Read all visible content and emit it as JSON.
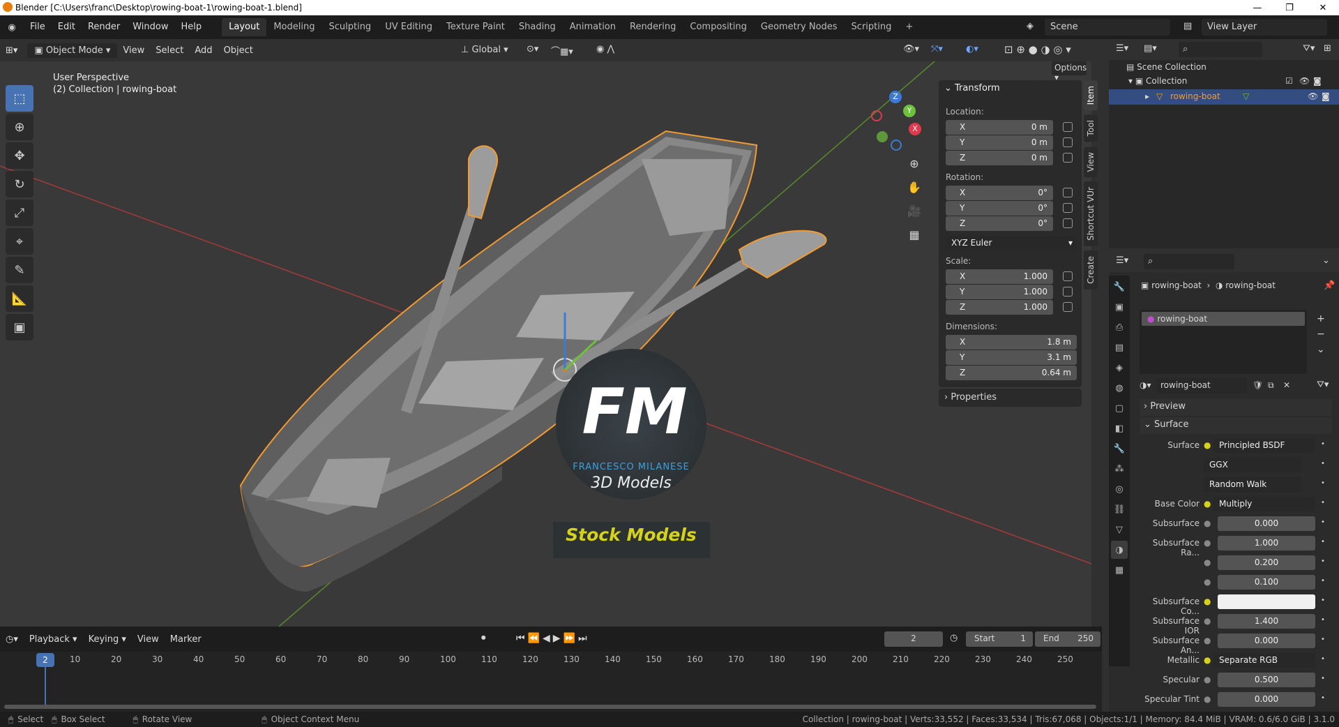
{
  "window": {
    "title": "Blender [C:\\Users\\franc\\Desktop\\rowing-boat-1\\rowing-boat-1.blend]"
  },
  "menu": [
    "File",
    "Edit",
    "Render",
    "Window",
    "Help"
  ],
  "workspaces": [
    "Layout",
    "Modeling",
    "Sculpting",
    "UV Editing",
    "Texture Paint",
    "Shading",
    "Animation",
    "Rendering",
    "Compositing",
    "Geometry Nodes",
    "Scripting"
  ],
  "scene": {
    "label": "Scene",
    "view_layer": "View Layer"
  },
  "viewport_header": {
    "mode": "Object Mode",
    "menus": [
      "View",
      "Select",
      "Add",
      "Object"
    ],
    "orientation": "Global",
    "options": "Options"
  },
  "viewport": {
    "perspective": "User Perspective",
    "collection_info": "(2) Collection | rowing-boat"
  },
  "gizmo": {
    "x": "X",
    "y": "Y",
    "z": "Z"
  },
  "watermark": {
    "letters": "FM",
    "name": "FRANCESCO MILANESE",
    "sub": "3D Models",
    "banner": "Stock Models"
  },
  "transform": {
    "title": "Transform",
    "location_label": "Location:",
    "location": [
      {
        "axis": "X",
        "value": "0 m"
      },
      {
        "axis": "Y",
        "value": "0 m"
      },
      {
        "axis": "Z",
        "value": "0 m"
      }
    ],
    "rotation_label": "Rotation:",
    "rotation": [
      {
        "axis": "X",
        "value": "0°"
      },
      {
        "axis": "Y",
        "value": "0°"
      },
      {
        "axis": "Z",
        "value": "0°"
      }
    ],
    "rotation_mode": "XYZ Euler",
    "scale_label": "Scale:",
    "scale": [
      {
        "axis": "X",
        "value": "1.000"
      },
      {
        "axis": "Y",
        "value": "1.000"
      },
      {
        "axis": "Z",
        "value": "1.000"
      }
    ],
    "dimensions_label": "Dimensions:",
    "dimensions": [
      {
        "axis": "X",
        "value": "1.8 m"
      },
      {
        "axis": "Y",
        "value": "3.1 m"
      },
      {
        "axis": "Z",
        "value": "0.64 m"
      }
    ],
    "properties": "Properties"
  },
  "side_tabs": [
    "Item",
    "Tool",
    "View",
    "Shortcut VUr",
    "Create"
  ],
  "outliner": {
    "scene_collection": "Scene Collection",
    "collection": "Collection",
    "object": "rowing-boat"
  },
  "properties": {
    "breadcrumb_object": "rowing-boat",
    "breadcrumb_material": "rowing-boat",
    "slot": "rowing-boat",
    "material_name": "rowing-boat",
    "preview": "Preview",
    "surface_section": "Surface",
    "rows": [
      {
        "label": "Surface",
        "value": "Principled BSDF",
        "kind": "drop"
      },
      {
        "label": "",
        "value": "GGX",
        "kind": "select"
      },
      {
        "label": "",
        "value": "Random Walk",
        "kind": "select"
      },
      {
        "label": "Base Color",
        "value": "Multiply",
        "kind": "drop"
      },
      {
        "label": "Subsurface",
        "value": "0.000",
        "kind": "num"
      },
      {
        "label": "Subsurface Ra...",
        "value": "1.000",
        "kind": "num"
      },
      {
        "label": "",
        "value": "0.200",
        "kind": "num"
      },
      {
        "label": "",
        "value": "0.100",
        "kind": "num"
      },
      {
        "label": "Subsurface Co...",
        "value": "",
        "kind": "color"
      },
      {
        "label": "Subsurface IOR",
        "value": "1.400",
        "kind": "num"
      },
      {
        "label": "Subsurface An...",
        "value": "0.000",
        "kind": "num"
      },
      {
        "label": "Metallic",
        "value": "Separate RGB",
        "kind": "drop"
      },
      {
        "label": "Specular",
        "value": "0.500",
        "kind": "num"
      },
      {
        "label": "Specular Tint",
        "value": "0.000",
        "kind": "num"
      }
    ]
  },
  "timeline": {
    "menus": [
      "Playback",
      "Keying",
      "View",
      "Marker"
    ],
    "current_frame": "2",
    "start_label": "Start",
    "start": "1",
    "end_label": "End",
    "end": "250",
    "ticks": [
      "10",
      "20",
      "30",
      "40",
      "50",
      "60",
      "70",
      "80",
      "90",
      "100",
      "110",
      "120",
      "130",
      "140",
      "150",
      "160",
      "170",
      "180",
      "190",
      "200",
      "210",
      "220",
      "230",
      "240",
      "250"
    ]
  },
  "status": {
    "select": "Select",
    "box_select": "Box Select",
    "rotate": "Rotate View",
    "context_menu": "Object Context Menu",
    "stats": "Collection | rowing-boat | Verts:33,552 | Faces:33,534 | Tris:67,068 | Objects:1/1 | Memory: 84.4 MiB | VRAM: 0.6/6.0 GiB | 3.1.0"
  }
}
